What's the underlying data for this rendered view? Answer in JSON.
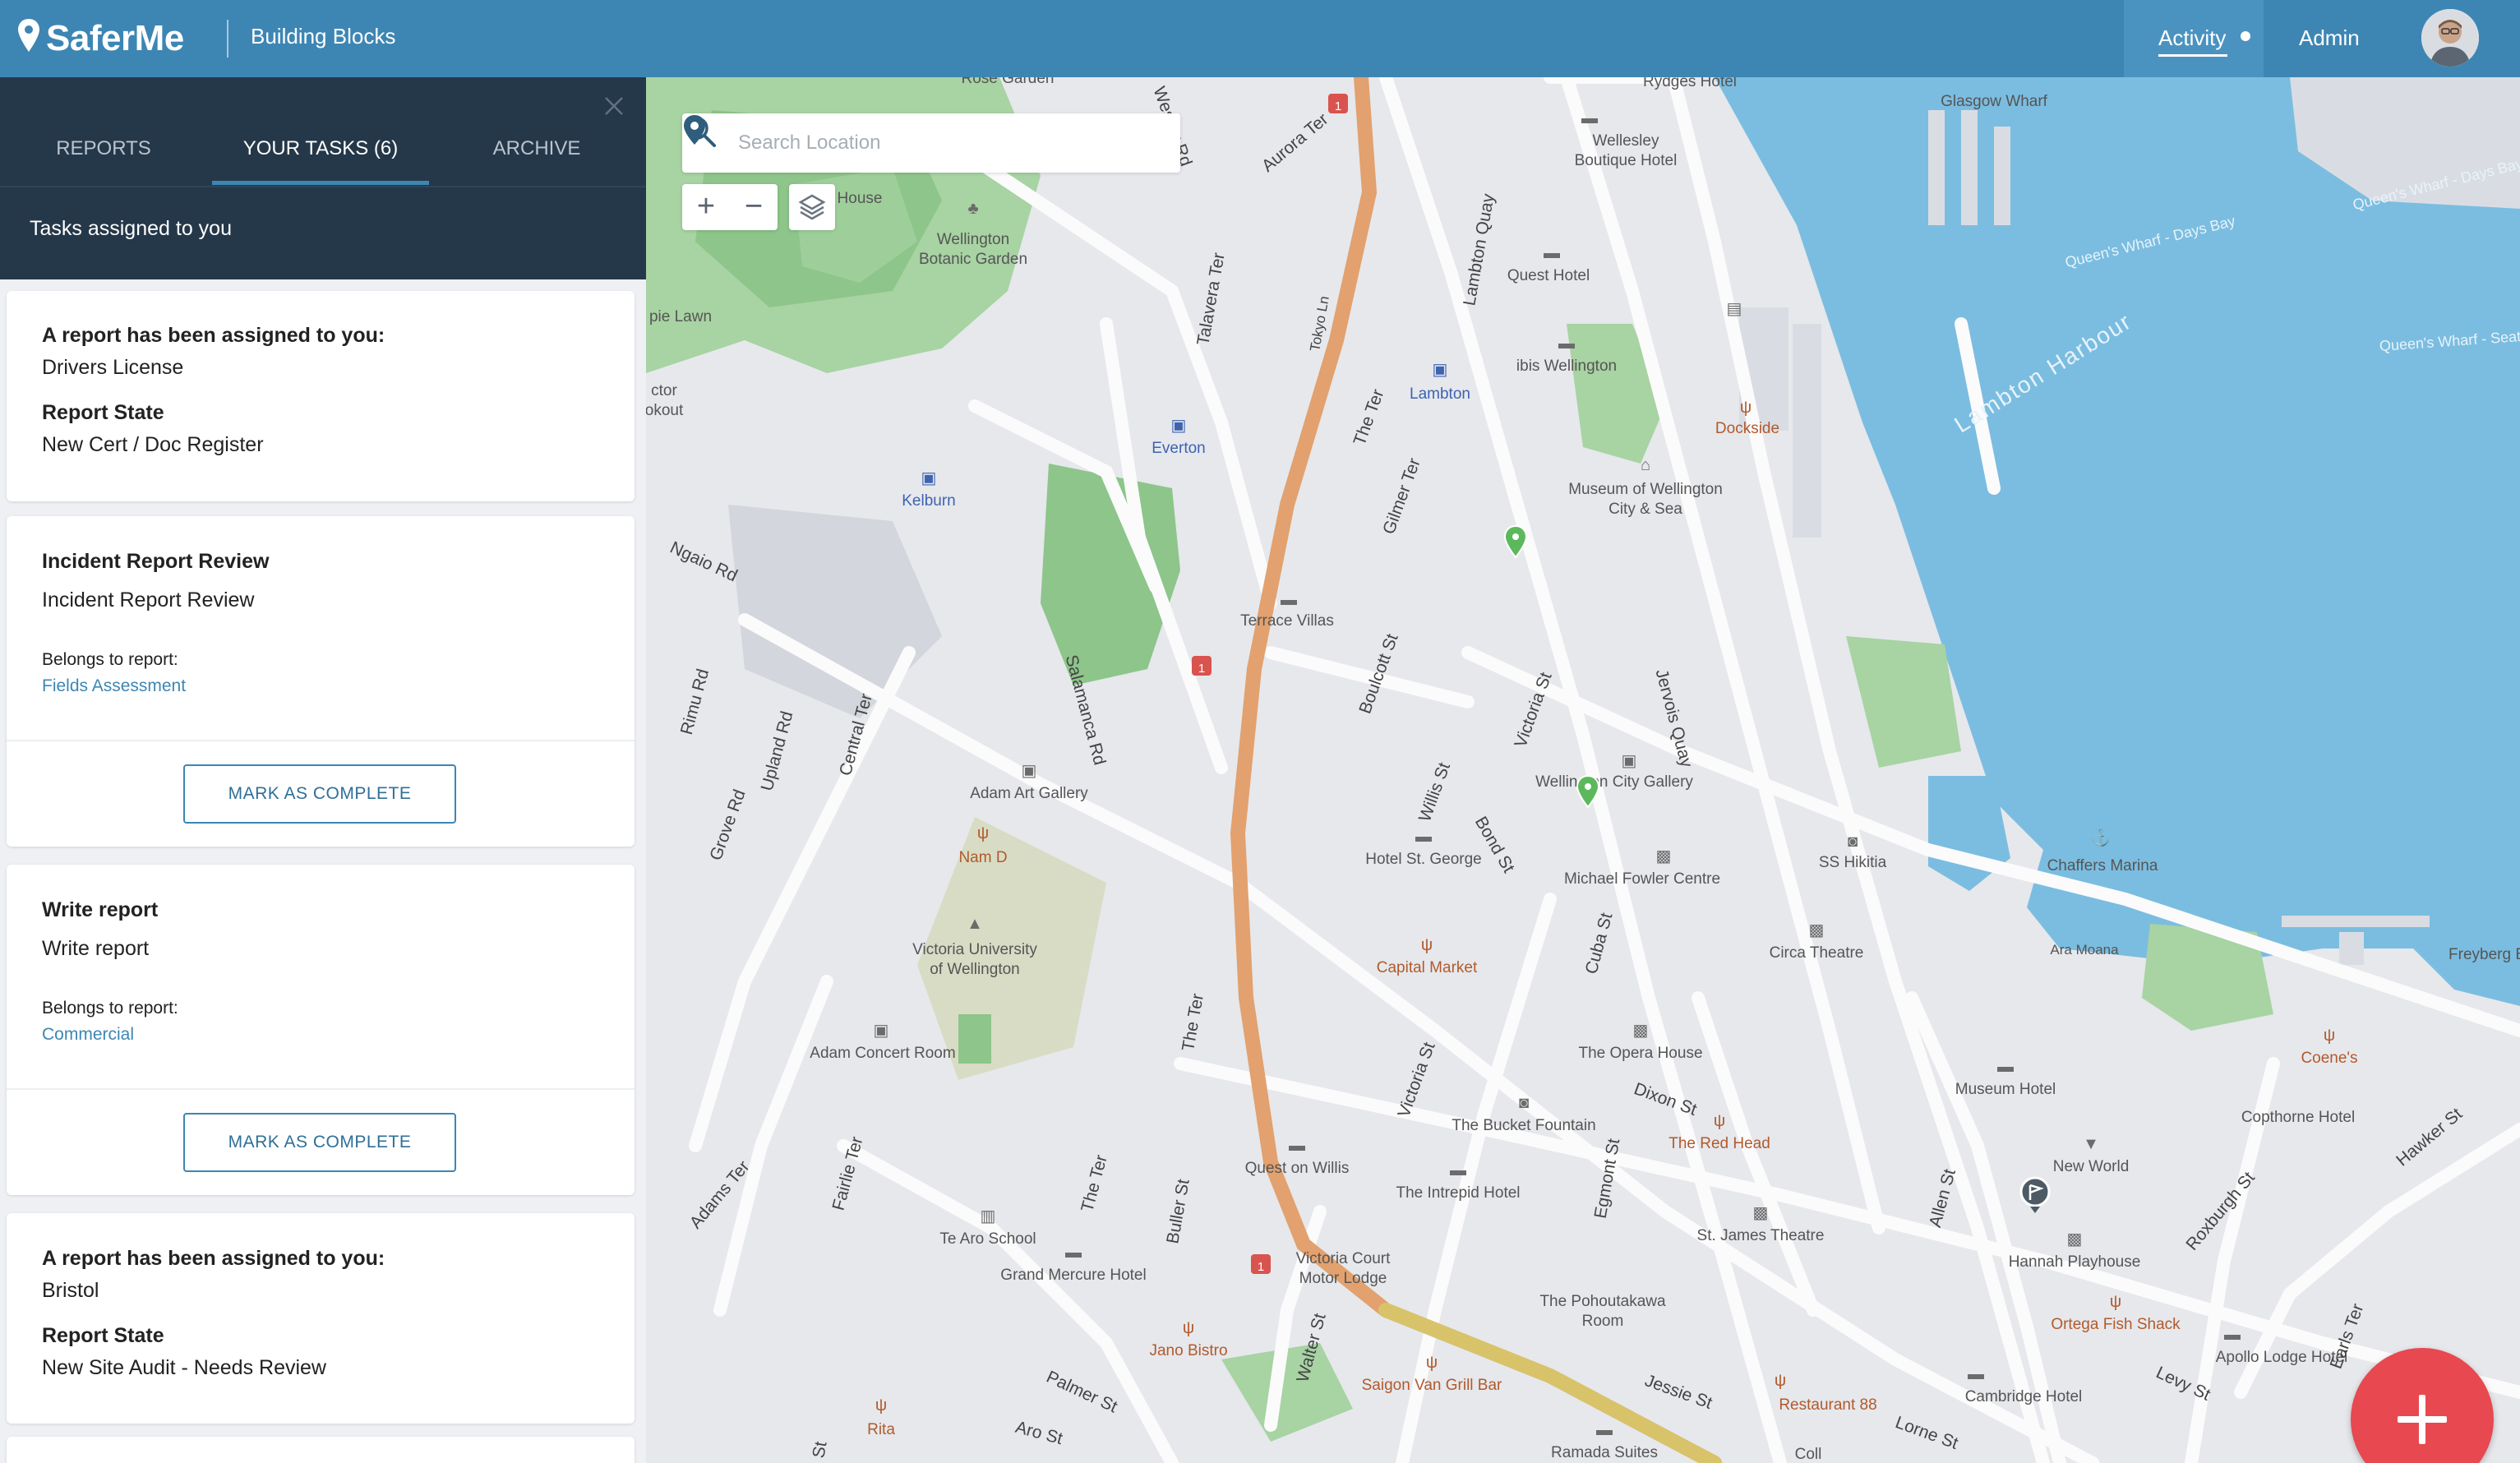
{
  "app": {
    "name": "SaferMe",
    "workspace": "Building Blocks",
    "brand_color": "#3d86b4",
    "accent_fab": "#e8484f"
  },
  "header": {
    "activity_label": "Activity",
    "admin_label": "Admin"
  },
  "panel": {
    "tabs": [
      {
        "label": "REPORTS"
      },
      {
        "label": "YOUR TASKS (6)"
      },
      {
        "label": "ARCHIVE"
      }
    ],
    "subtitle": "Tasks assigned to you",
    "close_icon": "close-icon",
    "cards": [
      {
        "title": "A report has been assigned to you:",
        "subtitle": "Drivers License",
        "state_label": "Report State",
        "state_value": "New Cert / Doc Register"
      },
      {
        "title": "Incident Report Review",
        "subtitle": "Incident Report Review",
        "belongs_label": "Belongs to report:",
        "report_link": "Fields Assessment",
        "action": "MARK AS COMPLETE"
      },
      {
        "title": "Write report",
        "subtitle": "Write report",
        "belongs_label": "Belongs to report:",
        "report_link": "Commercial",
        "action": "MARK AS COMPLETE"
      },
      {
        "title": "A report has been assigned to you:",
        "subtitle": "Bristol",
        "state_label": "Report State",
        "state_value": "New Site Audit - Needs Review"
      }
    ]
  },
  "map": {
    "search_placeholder": "Search Location",
    "zoom_in": "+",
    "zoom_out": "−",
    "labels": {
      "rose_garden": "Rose Garden",
      "wesley_rd": "Wesley Rd",
      "aurora_ter": "Aurora Ter",
      "rydges": "Rydges Hotel",
      "glasgow": "Glasgow Wharf",
      "wellesley": "Wellesley\nBoutique Hotel",
      "house": "House",
      "botanic": "Wellington\nBotanic Garden",
      "lawn": "pie Lawn",
      "ctor": "ctor\nokout",
      "quest": "Quest Hotel",
      "ibis": "ibis Wellington",
      "lambton": "Lambton",
      "lambton_quay": "Lambton Quay",
      "dockside": "Dockside",
      "everton": "Everton",
      "kelburn": "Kelburn",
      "museum": "Museum of Wellington\nCity & Sea",
      "talavera": "Talavera Ter",
      "tokyo": "Tokyo Ln",
      "the_ter": "The Ter",
      "gilmer": "Gilmer Ter",
      "ngaio": "Ngaio Rd",
      "terrace_villas": "Terrace Villas",
      "boulcott": "Boulcott St",
      "victoria_st": "Victoria St",
      "jervois": "Jervois Quay",
      "rimu": "Rimu Rd",
      "upland": "Upland Rd",
      "central_ter": "Central Ter",
      "salamanca": "Salamanca Rd",
      "willis": "Willis St",
      "bond": "Bond St",
      "city_gallery": "Wellington City Gallery",
      "adam_art": "Adam Art Gallery",
      "nam_d": "Nam D",
      "grove": "Grove Rd",
      "hotel_st_george": "Hotel St. George",
      "michael_fowler": "Michael Fowler Centre",
      "ss_hikitia": "SS Hikitia",
      "chaffers": "Chaffers Marina",
      "victoria_uni": "Victoria University\nof Wellington",
      "capital_market": "Capital Market",
      "cuba": "Cuba St",
      "circa": "Circa Theatre",
      "ara_moana": "Ara Moana",
      "freyberg": "Freyberg B",
      "adam_concert": "Adam Concert Room",
      "the_ter2": "The Ter",
      "victoria_st2": "Victoria St",
      "opera": "The Opera House",
      "dixon": "Dixon St",
      "museum_hotel": "Museum Hotel",
      "coenes": "Coene's",
      "copthorne": "Copthorne Hotel",
      "fairlie": "Fairlie Ter",
      "adams": "Adams Ter",
      "the_ter3": "The Ter",
      "buller": "Buller St",
      "bucket": "The Bucket Fountain",
      "egmont": "Egmont St",
      "red_head": "The Red Head",
      "new_world": "New World",
      "quest_willis": "Quest on Willis",
      "intrepid": "The Intrepid Hotel",
      "hawker": "Hawker St",
      "te_aro": "Te Aro School",
      "grand_mercure": "Grand Mercure Hotel",
      "vic_court": "Victoria Court\nMotor Lodge",
      "st_james": "St. James Theatre",
      "allen": "Allen St",
      "hannah": "Hannah Playhouse",
      "roxburgh": "Roxburgh St",
      "pohoutakawa": "The Pohoutakawa\nRoom",
      "ortega": "Ortega Fish Shack",
      "apollo": "Apollo Lodge Hotel",
      "jano": "Jano Bistro",
      "walter": "Walter St",
      "saigon": "Saigon Van Grill Bar",
      "palmer": "Palmer St",
      "jessie": "Jessie St",
      "restaurant88": "Restaurant 88",
      "levy": "Levy St",
      "cambridge": "Cambridge Hotel",
      "earls": "Earls Ter",
      "rita": "Rita",
      "aro": "Aro St",
      "ramada": "Ramada Suites",
      "lorne": "Lorne St",
      "coll": "Coll",
      "st": "St",
      "harbour": "Lambton Harbour",
      "queens1": "Queen's Wharf - Days Bay",
      "queens2": "Queen's Wharf - Days Bay",
      "queens3": "Queen's Wharf - Seatoun",
      "route_1": "1"
    }
  }
}
